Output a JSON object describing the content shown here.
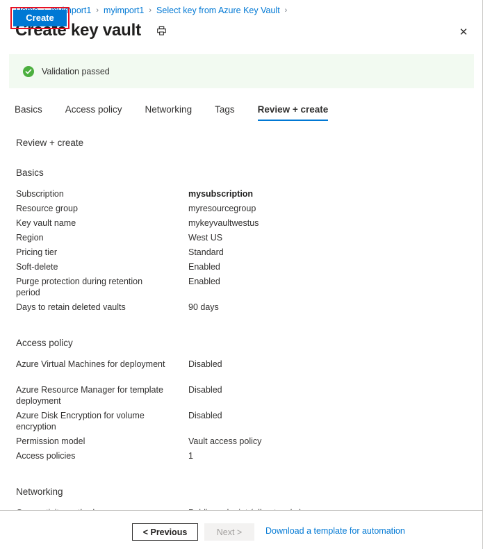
{
  "breadcrumb": {
    "items": [
      "Home",
      "myimport1",
      "myimport1",
      "Select key from Azure Key Vault"
    ],
    "separator": "›"
  },
  "header": {
    "title": "Create key vault",
    "print_icon": "printer-icon",
    "close_icon": "close-icon",
    "close_glyph": "✕"
  },
  "validation": {
    "text": "Validation passed",
    "icon": "check-circle-icon",
    "background": "#f2faf1",
    "icon_color": "#4caf3f"
  },
  "tabs": [
    {
      "label": "Basics",
      "active": false
    },
    {
      "label": "Access policy",
      "active": false
    },
    {
      "label": "Networking",
      "active": false
    },
    {
      "label": "Tags",
      "active": false
    },
    {
      "label": "Review + create",
      "active": true
    }
  ],
  "summary_heading": "Review + create",
  "sections": [
    {
      "heading": "Basics",
      "value_left": "248px",
      "rows": [
        {
          "key": "Subscription",
          "value": "mysubscription",
          "bold": true
        },
        {
          "key": "Resource group",
          "value": "myresourcegroup",
          "bold": false
        },
        {
          "key": "Key vault name",
          "value": "mykeyvaultwestus",
          "bold": false
        },
        {
          "key": "Region",
          "value": "West US",
          "bold": false
        },
        {
          "key": "Pricing tier",
          "value": "Standard",
          "bold": false
        },
        {
          "key": "Soft-delete",
          "value": "Enabled",
          "bold": false
        },
        {
          "key": "Purge protection during retention period",
          "value": "Enabled",
          "bold": false
        },
        {
          "key": "Days to retain deleted vaults",
          "value": "90 days",
          "bold": false
        }
      ]
    },
    {
      "heading": "Access policy",
      "value_left": "248px",
      "rows": [
        {
          "key": "Azure Virtual Machines for deployment",
          "value": "Disabled",
          "bold": false
        },
        {
          "key": "Azure Resource Manager for template deployment",
          "value": "Disabled",
          "bold": false
        },
        {
          "key": "Azure Disk Encryption for volume encryption",
          "value": "Disabled",
          "bold": false
        },
        {
          "key": "Permission model",
          "value": "Vault access policy",
          "bold": false
        },
        {
          "key": "Access policies",
          "value": "1",
          "bold": false
        }
      ]
    },
    {
      "heading": "Networking",
      "value_left": "248px",
      "rows": [
        {
          "key": "Connectivity method",
          "value": "Public endpoint (all networks)",
          "bold": false
        }
      ]
    }
  ],
  "footer": {
    "create_label": "Create",
    "create_highlight_color": "#e81123",
    "create_color": "#0078d4",
    "previous_label": "< Previous",
    "next_label": "Next >",
    "next_disabled": true,
    "download_label": "Download a template for automation",
    "link_color": "#0078d4"
  }
}
